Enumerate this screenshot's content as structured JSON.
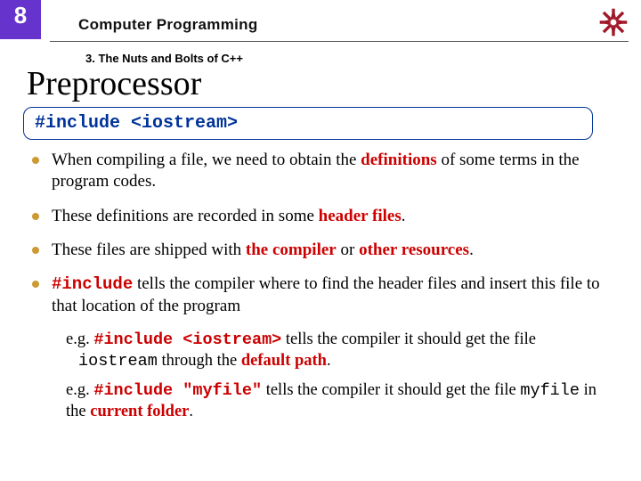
{
  "slide_number": "8",
  "course_title": "Computer Programming",
  "chapter": "3. The Nuts and Bolts of C++",
  "main_title": "Preprocessor",
  "code_box": "#include <iostream>",
  "bullets": {
    "b1a": "When compiling a file, we need to obtain the ",
    "b1b": "definitions",
    "b1c": " of some terms in the program codes.",
    "b2a": "These definitions are recorded in some ",
    "b2b": "header files",
    "b2c": ".",
    "b3a": "These files are shipped with ",
    "b3b": "the compiler",
    "b3c": " or ",
    "b3d": "other resources",
    "b3e": ".",
    "b4a": "#include",
    "b4b": " tells the compiler where to find the header files and insert this file to that location of the program"
  },
  "examples": {
    "e1a": "e.g. ",
    "e1b": "#include <iostream>",
    "e1c": " tells the compiler it should get the file ",
    "e1d": "iostream",
    "e1e": " through the ",
    "e1f": "default path",
    "e1g": ".",
    "e2a": "e.g. ",
    "e2b": "#include \"myfile\"",
    "e2c": " tells the compiler it should get the file ",
    "e2d": "myfile",
    "e2e": " in the ",
    "e2f": "current folder",
    "e2g": "."
  }
}
